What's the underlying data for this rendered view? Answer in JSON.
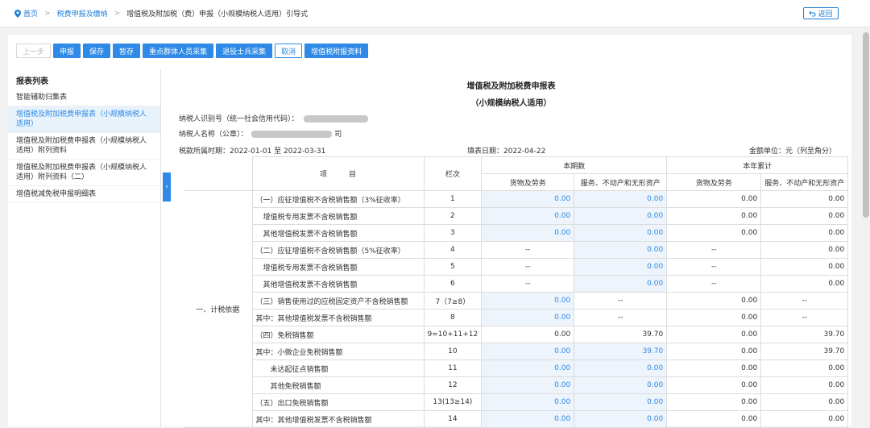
{
  "breadcrumb": {
    "home": "首页",
    "section": "税费申报及缴纳",
    "current": "增值税及附加税（费）申报（小规模纳税人适用）引导式"
  },
  "back_label": "返回",
  "toolbar": {
    "prev": "上一步",
    "declare": "申报",
    "save": "保存",
    "hold": "暂存",
    "key_group": "重点群体人员采集",
    "veteran": "退役士兵采集",
    "cancel": "取消",
    "attach": "增值税附报资料"
  },
  "sidebar": {
    "title": "报表列表",
    "items": [
      {
        "label": "智能辅助归集表"
      },
      {
        "label": "增值税及附加税费申报表（小规模纳税人适用）"
      },
      {
        "label": "增值税及附加税费申报表（小规模纳税人适用）附列资料"
      },
      {
        "label": "增值税及附加税费申报表（小规模纳税人适用）附列资料（二）"
      },
      {
        "label": "增值税减免税申报明细表"
      }
    ]
  },
  "form": {
    "title": "增值税及附加税费申报表",
    "subtitle": "（小规模纳税人适用）",
    "taxpayer_id_label": "纳税人识别号（统一社会信用代码）：",
    "taxpayer_name_label": "纳税人名称（公章）：",
    "name_suffix": "司",
    "period_label": "税款所属时期：2022-01-01 至 2022-03-31",
    "fill_date_label": "填表日期：2022-04-22",
    "unit_label": "金额单位：元（列至角分）"
  },
  "table": {
    "headers": {
      "item": "项　　　目",
      "col": "栏次",
      "current_period": "本期数",
      "year_total": "本年累计",
      "goods": "货物及劳务",
      "services": "服务、不动产和无形资产"
    },
    "category": "一、计税依据",
    "rows": [
      {
        "item": "（一）应征增值税不含税销售额（3%征收率）",
        "col": "1",
        "v1": "0.00",
        "v2": "0.00",
        "v3": "0.00",
        "v4": "0.00"
      },
      {
        "item": "　增值税专用发票不含税销售额",
        "col": "2",
        "v1": "0.00",
        "v2": "0.00",
        "v3": "0.00",
        "v4": "0.00"
      },
      {
        "item": "　其他增值税发票不含税销售额",
        "col": "3",
        "v1": "0.00",
        "v2": "0.00",
        "v3": "0.00",
        "v4": "0.00"
      },
      {
        "item": "（二）应征增值税不含税销售额（5%征收率）",
        "col": "4",
        "v1": "--",
        "v2": "0.00",
        "v3": "--",
        "v4": "0.00"
      },
      {
        "item": "　增值税专用发票不含税销售额",
        "col": "5",
        "v1": "--",
        "v2": "0.00",
        "v3": "--",
        "v4": "0.00"
      },
      {
        "item": "　其他增值税发票不含税销售额",
        "col": "6",
        "v1": "--",
        "v2": "0.00",
        "v3": "--",
        "v4": "0.00"
      },
      {
        "item": "（三）销售使用过的应税固定资产不含税销售额",
        "col": "7（7≥8）",
        "v1": "0.00",
        "v2": "--",
        "v3": "0.00",
        "v4": "--"
      },
      {
        "item": "其中：其他增值税发票不含税销售额",
        "col": "8",
        "v1": "0.00",
        "v2": "--",
        "v3": "0.00",
        "v4": "--"
      },
      {
        "item": "（四）免税销售额",
        "col": "9=10+11+12",
        "v1": "0.00",
        "v2": "39.70",
        "v3": "0.00",
        "v4": "39.70"
      },
      {
        "item": "其中：小微企业免税销售额",
        "col": "10",
        "v1": "0.00",
        "v2": "39.70",
        "v3": "0.00",
        "v4": "39.70"
      },
      {
        "item": "　　未达起征点销售额",
        "col": "11",
        "v1": "0.00",
        "v2": "0.00",
        "v3": "0.00",
        "v4": "0.00"
      },
      {
        "item": "　　其他免税销售额",
        "col": "12",
        "v1": "0.00",
        "v2": "0.00",
        "v3": "0.00",
        "v4": "0.00"
      },
      {
        "item": "（五）出口免税销售额",
        "col": "13(13≥14)",
        "v1": "0.00",
        "v2": "0.00",
        "v3": "0.00",
        "v4": "0.00"
      },
      {
        "item": "其中：其他增值税发票不含税销售额",
        "col": "14",
        "v1": "0.00",
        "v2": "0.00",
        "v3": "0.00",
        "v4": "0.00"
      }
    ]
  },
  "colors": {
    "accent": "#2e8ae6",
    "input_bg": "#edf4fc"
  }
}
